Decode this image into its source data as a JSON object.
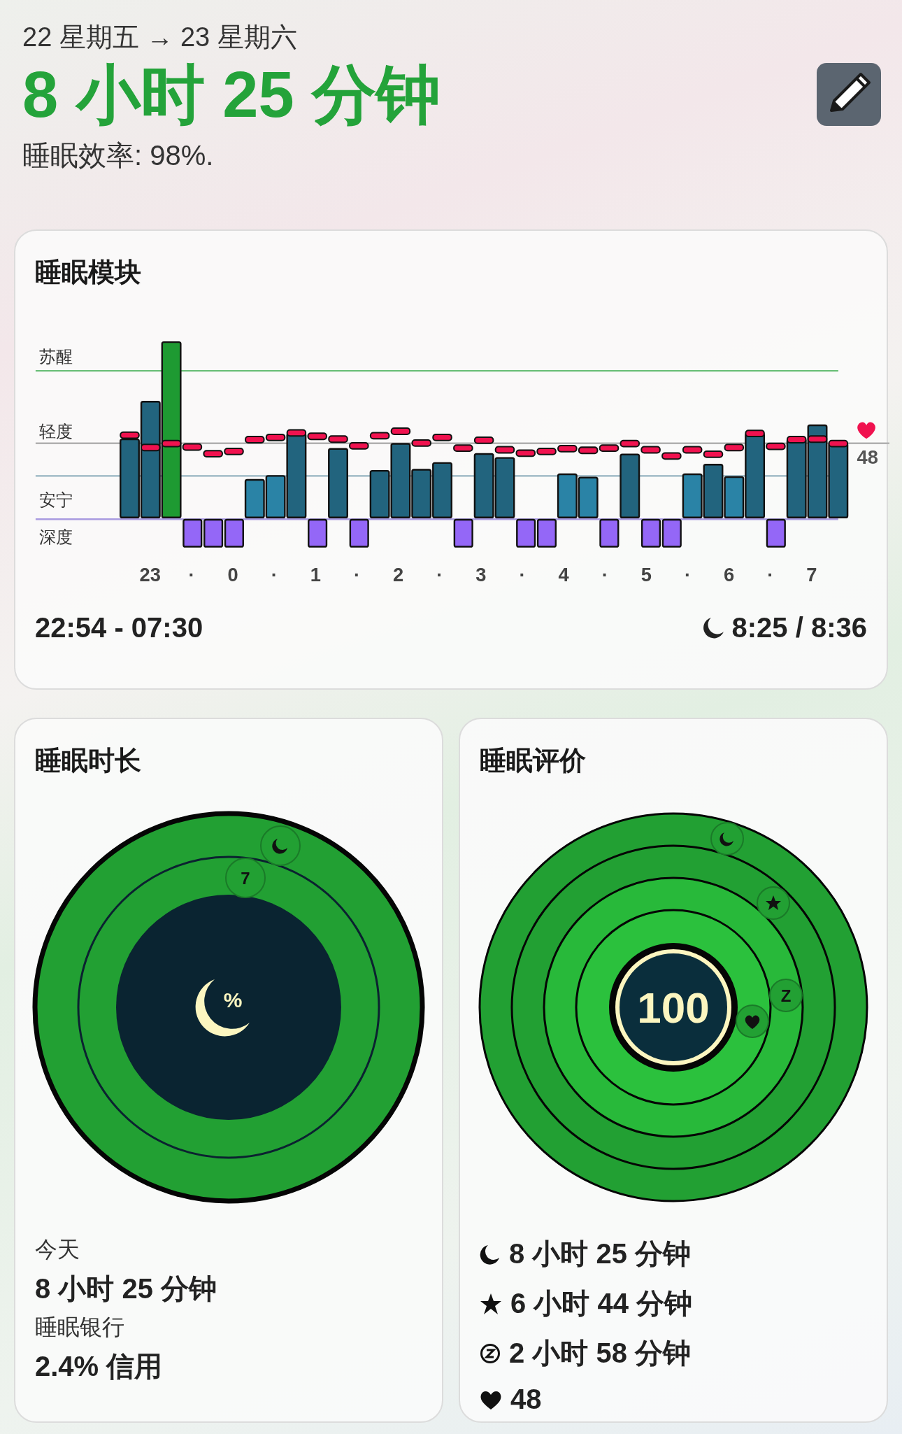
{
  "header": {
    "date_range": "22 星期五 → 23 星期六",
    "duration": "8 小时 25 分钟",
    "efficiency": "睡眠效率: 98%."
  },
  "sleep_stages_card": {
    "title": "睡眠模块",
    "stage_labels": [
      "苏醒",
      "轻度",
      "安宁",
      "深度"
    ],
    "heart_rate": "48",
    "x_labels": [
      "23",
      "·",
      "0",
      "·",
      "1",
      "·",
      "2",
      "·",
      "3",
      "·",
      "4",
      "·",
      "5",
      "·",
      "6",
      "·",
      "7"
    ],
    "time_range": "22:54 - 07:30",
    "sleep_total": "8:25 / 8:36"
  },
  "duration_card": {
    "title": "睡眠时长",
    "badge": "7",
    "center_symbol": "%",
    "today_label": "今天",
    "today_value": "8 小时 25 分钟",
    "bank_label": "睡眠银行",
    "bank_value": "2.4% 信用"
  },
  "score_card": {
    "title": "睡眠评价",
    "score": "100",
    "badge": "Z",
    "stats": [
      {
        "kind": "moon",
        "text": "8 小时 25 分钟"
      },
      {
        "kind": "star",
        "text": "6 小时 44 分钟"
      },
      {
        "kind": "zzz",
        "text": "2 小时 58 分钟"
      },
      {
        "kind": "heart",
        "text": "48"
      }
    ]
  }
}
